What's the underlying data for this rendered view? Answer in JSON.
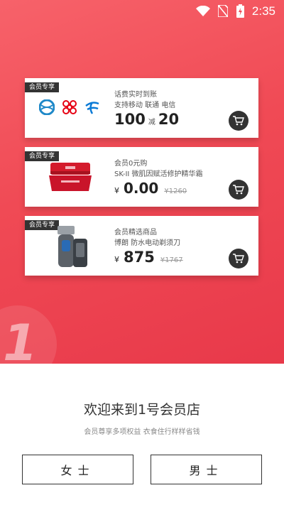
{
  "status_bar": {
    "time": "2:35"
  },
  "cards": [
    {
      "tag": "会员专享",
      "title": "话费实时到账",
      "subtitle": "支持移动 联通 电信",
      "price": "100",
      "mid": "减",
      "price2": "20"
    },
    {
      "tag": "会员专享",
      "title": "会员0元购",
      "subtitle": "SK-II 微肌因赋活修护精华霜",
      "yen": "¥",
      "price": "0.00",
      "old_price": "¥1260"
    },
    {
      "tag": "会员专享",
      "title": "会员精选商品",
      "subtitle": "博朗 防水电动剃须刀",
      "yen": "¥",
      "price": "875",
      "old_price": "¥1767"
    }
  ],
  "welcome": {
    "title": "欢迎来到1号会员店",
    "tagline": "会员尊享多项权益 衣食住行样样省钱"
  },
  "buttons": {
    "female": "女士",
    "male": "男士"
  },
  "colors": {
    "hero": "#f04a55",
    "dark": "#333333"
  }
}
